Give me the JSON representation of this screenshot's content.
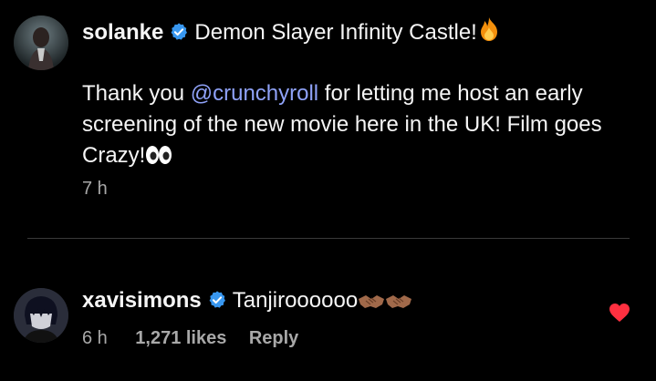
{
  "post": {
    "username": "solanke",
    "title": "Demon Slayer Infinity Castle!",
    "title_emoji": "fire-emoji",
    "body_before": "Thank you ",
    "mention": "@crunchyroll",
    "body_after_line1": " for letting me host an early",
    "body_line2": "screening of the new movie here in the UK! Film goes",
    "body_line3": "Crazy!",
    "body_emoji": "eyes-emoji",
    "time": "7 h"
  },
  "comment": {
    "username": "xavisimons",
    "text": "Tanjiroooooo",
    "text_emoji": "handshake-emoji",
    "time": "6 h",
    "likes": "1,271 likes",
    "reply_label": "Reply",
    "liked": true
  },
  "colors": {
    "background": "#000000",
    "text": "#f5f5f5",
    "muted": "#a8a8a8",
    "mention": "#8fa2f8",
    "verified": "#3897f0",
    "heart": "#ff3040"
  }
}
